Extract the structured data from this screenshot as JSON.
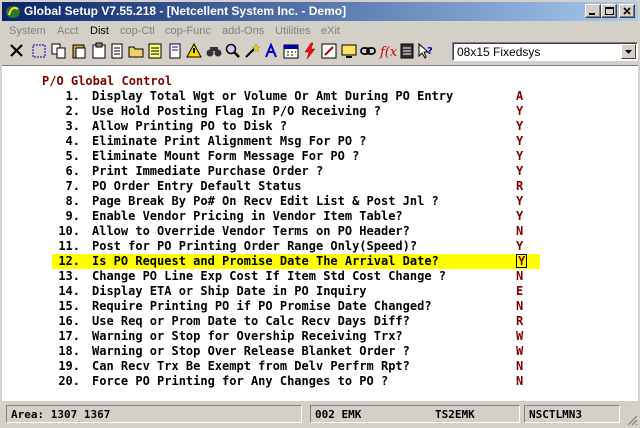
{
  "window": {
    "title": "Global Setup V7.55.218 - [Netcellent System Inc. - Demo]"
  },
  "menu": [
    {
      "label": "System",
      "active": false
    },
    {
      "label": "Acct",
      "active": false
    },
    {
      "label": "Dist",
      "active": true
    },
    {
      "label": "cop-Ctl",
      "active": false
    },
    {
      "label": "cop-Func",
      "active": false
    },
    {
      "label": "add-Ons",
      "active": false
    },
    {
      "label": "Utilities",
      "active": false
    },
    {
      "label": "eXit",
      "active": false
    }
  ],
  "toolbar": {
    "font_select_value": "08x15 Fixedsys"
  },
  "screen": {
    "heading": "P/O Global Control",
    "rows": [
      {
        "num": "1.",
        "label": "Display Total Wgt or Volume Or Amt During PO Entry",
        "value": "A"
      },
      {
        "num": "2.",
        "label": "Use Hold Posting Flag In P/O Receiving ?",
        "value": "Y"
      },
      {
        "num": "3.",
        "label": "Allow Printing PO to Disk ?",
        "value": "Y"
      },
      {
        "num": "4.",
        "label": "Eliminate Print Alignment Msg For PO ?",
        "value": "Y"
      },
      {
        "num": "5.",
        "label": "Eliminate Mount Form Message For PO ?",
        "value": "Y"
      },
      {
        "num": "6.",
        "label": "Print Immediate Purchase Order ?",
        "value": "Y"
      },
      {
        "num": "7.",
        "label": "PO Order Entry Default Status",
        "value": "R"
      },
      {
        "num": "8.",
        "label": "Page Break By Po# On Recv Edit List & Post Jnl ?",
        "value": "Y"
      },
      {
        "num": "9.",
        "label": "Enable Vendor Pricing in Vendor Item Table?",
        "value": "Y"
      },
      {
        "num": "10.",
        "label": "Allow to Override Vendor Terms on PO Header?",
        "value": "N"
      },
      {
        "num": "11.",
        "label": "Post for PO Printing Order Range Only(Speed)?",
        "value": "Y"
      },
      {
        "num": "12.",
        "label": "Is PO Request and Promise Date The Arrival Date?",
        "value": "Y"
      },
      {
        "num": "13.",
        "label": "Change PO Line Exp Cost If Item Std Cost Change ?",
        "value": "N"
      },
      {
        "num": "14.",
        "label": "Display ETA or Ship Date in PO Inquiry",
        "value": "E"
      },
      {
        "num": "15.",
        "label": "Require Printing PO if PO Promise Date Changed?",
        "value": "N"
      },
      {
        "num": "16.",
        "label": "Use Req or Prom Date to Calc Recv Days Diff?",
        "value": "R"
      },
      {
        "num": "17.",
        "label": "Warning or Stop for Overship Receiving Trx?",
        "value": "W"
      },
      {
        "num": "18.",
        "label": "Warning or Stop Over Release Blanket Order ?",
        "value": "W"
      },
      {
        "num": "19.",
        "label": "Can Recv Trx Be Exempt from Delv Perfrm Rpt?",
        "value": "N"
      },
      {
        "num": "20.",
        "label": "Force PO Printing for Any Changes to PO ?",
        "value": "N"
      }
    ],
    "highlight_index": 11
  },
  "status": {
    "area": "Area: 1307 1367",
    "user": "002 EMK",
    "terminal": "TS2EMK",
    "machine": "NSCTLMN3"
  },
  "colors": {
    "highlight": "#ffff00",
    "value_color": "#800000",
    "title_start": "#0a246a",
    "title_end": "#a6caf0"
  }
}
